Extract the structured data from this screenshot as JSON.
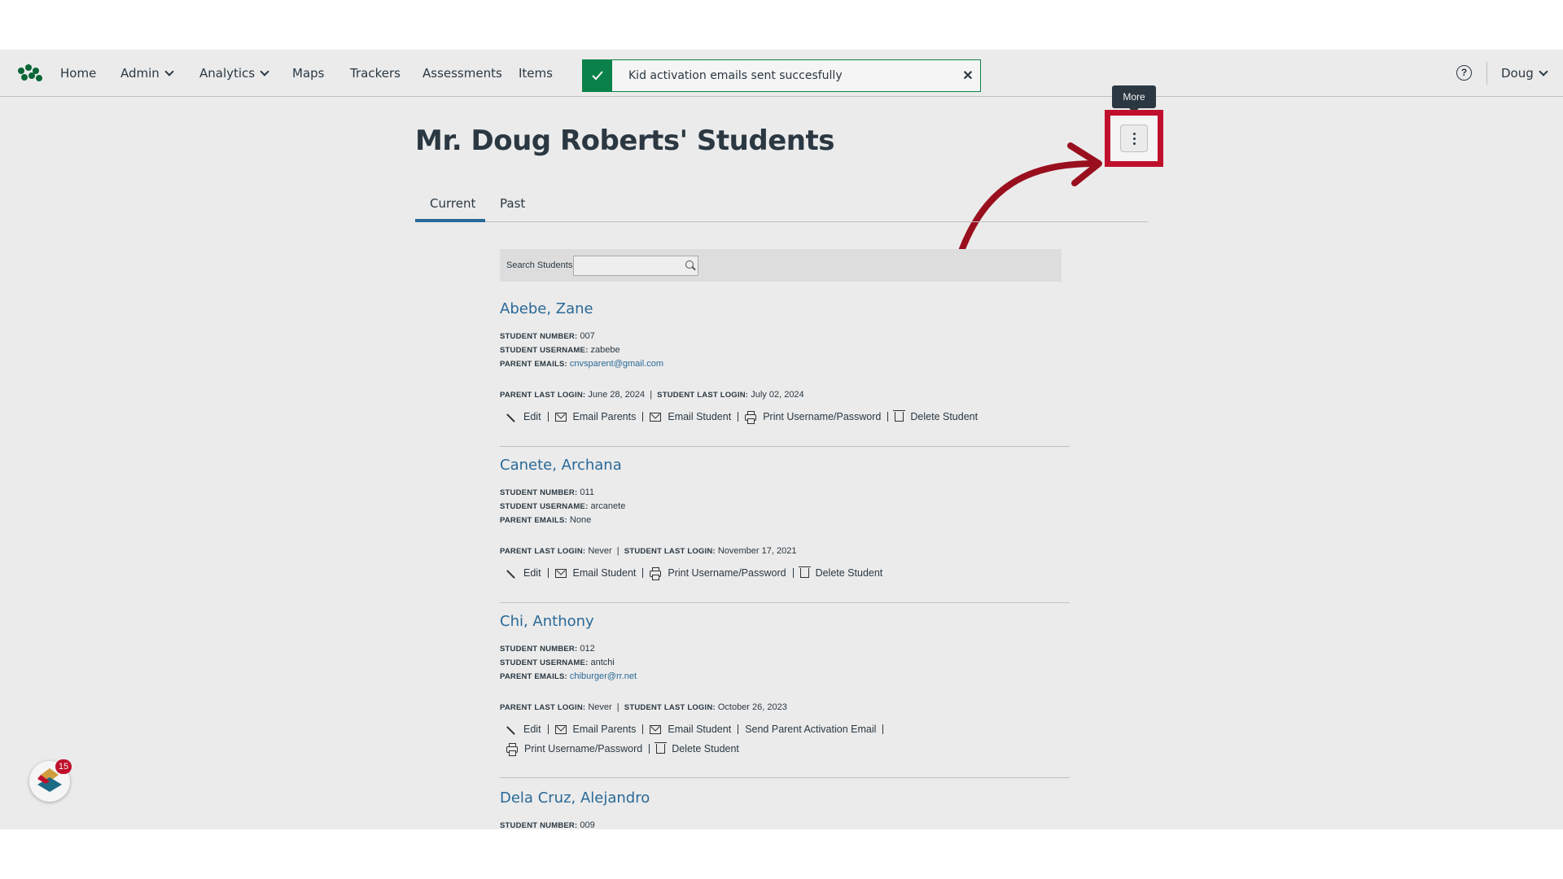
{
  "nav": {
    "items": [
      "Home",
      "Admin",
      "Analytics",
      "Maps",
      "Trackers",
      "Assessments",
      "Items"
    ],
    "user": "Doug",
    "help_icon": "question-circle-icon"
  },
  "toast": {
    "message": "Kid activation emails sent succesfully",
    "close": "✕"
  },
  "page": {
    "title": "Mr. Doug Roberts' Students",
    "tooltip": "More"
  },
  "tabs": [
    "Current",
    "Past"
  ],
  "search": {
    "label": "Search Students",
    "placeholder": ""
  },
  "labels": {
    "student_number": "STUDENT NUMBER:",
    "student_username": "STUDENT USERNAME:",
    "parent_emails": "PARENT EMAILS:",
    "parent_last_login": "PARENT LAST LOGIN:",
    "student_last_login": "STUDENT LAST LOGIN:"
  },
  "students": [
    {
      "name": "Abebe, Zane",
      "number": "007",
      "username": "zabebe",
      "parent_emails": "cnvsparent@gmail.com",
      "parent_last_login": "June 28, 2024",
      "student_last_login": "July 02, 2024",
      "actions": [
        "Edit",
        "Email Parents",
        "Email Student",
        "Print Username/Password",
        "Delete Student"
      ]
    },
    {
      "name": "Canete, Archana",
      "number": "011",
      "username": "arcanete",
      "parent_emails": "None",
      "parent_last_login": "Never",
      "student_last_login": "November 17, 2021",
      "actions": [
        "Edit",
        "Email Student",
        "Print Username/Password",
        "Delete Student"
      ]
    },
    {
      "name": "Chi, Anthony",
      "number": "012",
      "username": "antchi",
      "parent_emails": "chiburger@rr.net",
      "parent_last_login": "Never",
      "student_last_login": "October 26, 2023",
      "actions": [
        "Edit",
        "Email Parents",
        "Email Student",
        "Send Parent Activation Email",
        "Print Username/Password",
        "Delete Student"
      ]
    },
    {
      "name": "Dela Cruz, Alejandro",
      "number": "009"
    }
  ],
  "notification_badge": "15",
  "colors": {
    "accent": "#2b6e9e",
    "success": "#0b874b",
    "highlight": "#c8102e"
  }
}
